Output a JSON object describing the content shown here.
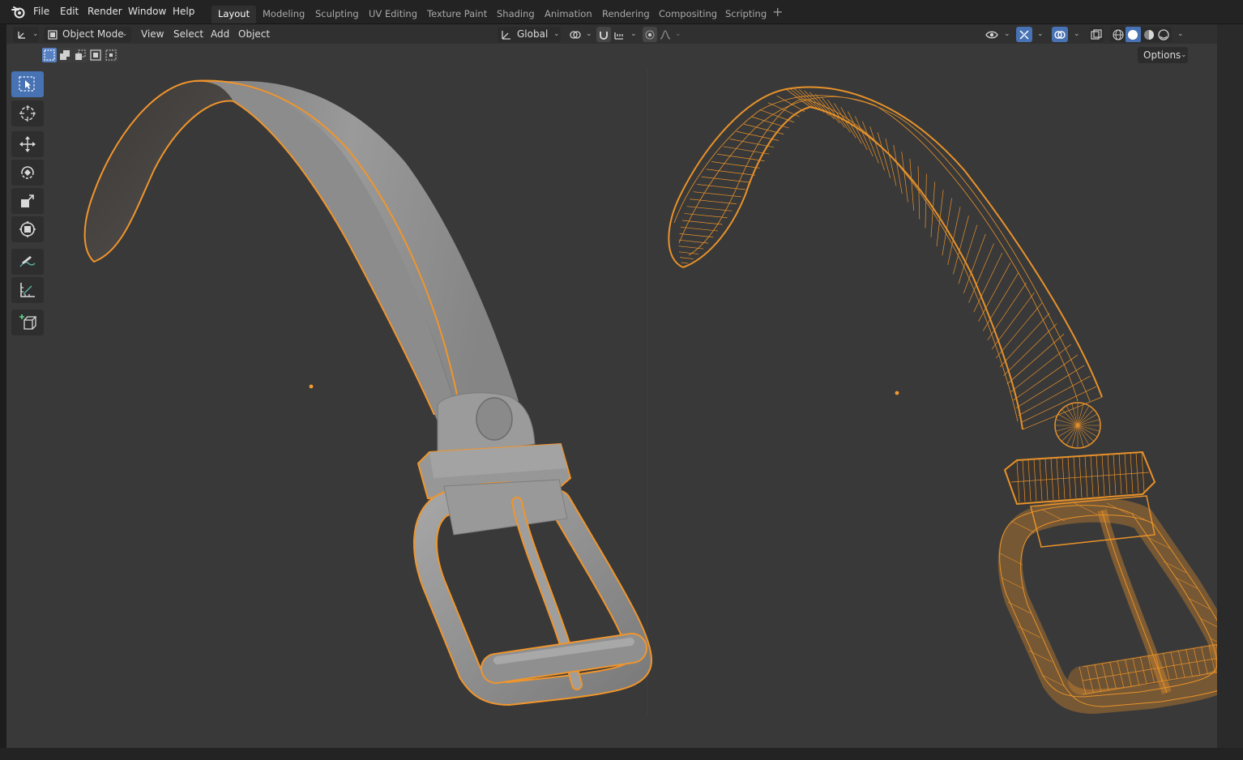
{
  "menu": {
    "items": [
      "File",
      "Edit",
      "Render",
      "Window",
      "Help"
    ]
  },
  "workspaces": {
    "tabs": [
      "Layout",
      "Modeling",
      "Sculpting",
      "UV Editing",
      "Texture Paint",
      "Shading",
      "Animation",
      "Rendering",
      "Compositing",
      "Scripting"
    ],
    "active": "Layout"
  },
  "viewport_header": {
    "mode": "Object Mode",
    "menus": [
      "View",
      "Select",
      "Add",
      "Object"
    ],
    "orientation": "Global",
    "options_label": "Options"
  },
  "toolbar": {
    "tools": [
      "select-box",
      "cursor",
      "move",
      "rotate",
      "scale",
      "transform",
      "annotate",
      "measure",
      "add-cube"
    ],
    "active": "select-box"
  },
  "colors": {
    "selection_outline": "#f0952c",
    "wire": "#e8922a",
    "accent": "#4772b3",
    "viewport_bg": "#393939"
  }
}
